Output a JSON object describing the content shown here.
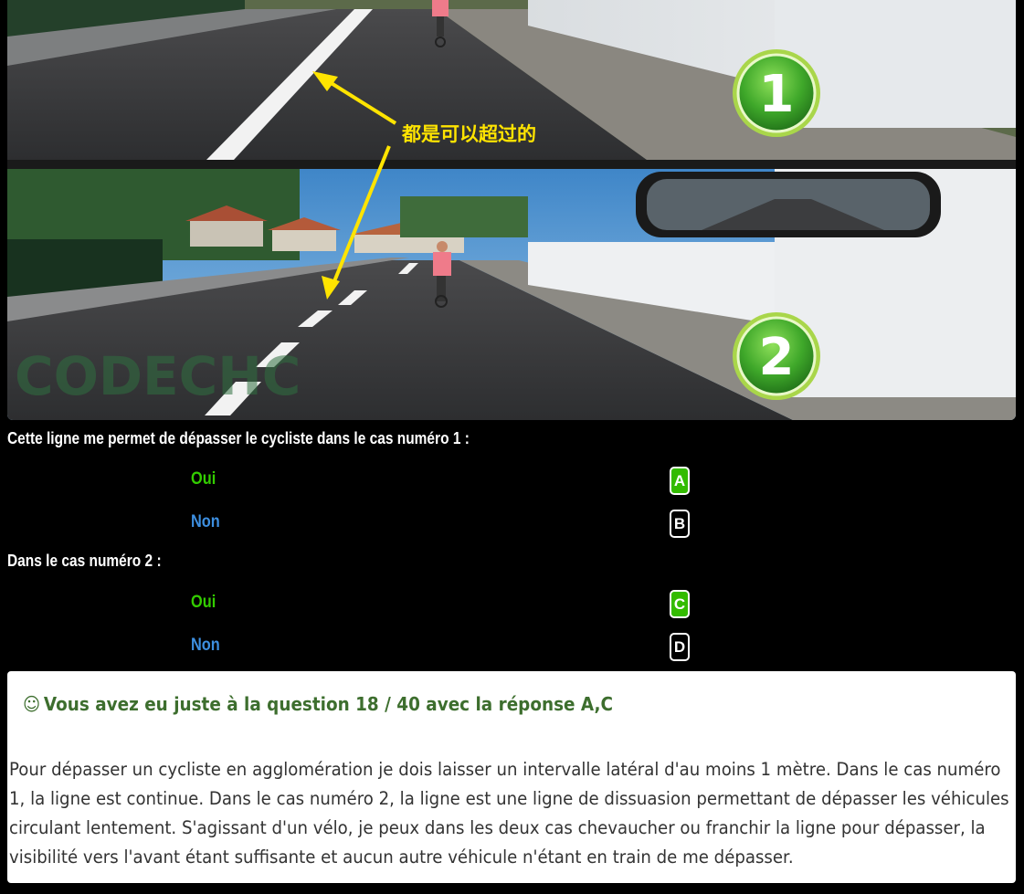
{
  "image": {
    "annotation_chinese": "都是可以超过的",
    "badge_1": "1",
    "badge_2": "2",
    "watermark": "CODECHC"
  },
  "question1": {
    "text": "Cette ligne me permet de dépasser le cycliste dans le cas numéro 1 :",
    "options": [
      {
        "label": "Oui",
        "letter": "A",
        "selected": true
      },
      {
        "label": "Non",
        "letter": "B",
        "selected": false
      }
    ]
  },
  "question2": {
    "text": "Dans le cas numéro 2 :",
    "options": [
      {
        "label": "Oui",
        "letter": "C",
        "selected": true
      },
      {
        "label": "Non",
        "letter": "D",
        "selected": false
      }
    ]
  },
  "result": {
    "icon": "smiley-icon",
    "title": "Vous avez eu juste à la question 18 / 40 avec la réponse A,C",
    "explanation": "Pour dépasser un cycliste en agglomération je dois laisser un intervalle latéral d'au moins 1 mètre. Dans le cas numéro 1, la ligne est continue. Dans le cas numéro 2, la ligne est une ligne de dissuasion permettant de dépasser les véhicules circulant lentement. S'agissant d'un vélo, je peux dans les deux cas chevaucher ou franchir la ligne pour dépasser, la visibilité vers l'avant étant suffisante et aucun autre véhicule n'étant en train de me dépasser."
  },
  "colors": {
    "correct_green": "#33cc00",
    "answer_blue": "#3d8fe0",
    "result_title": "#3d6e2e",
    "annotation_yellow": "#ffe400"
  }
}
